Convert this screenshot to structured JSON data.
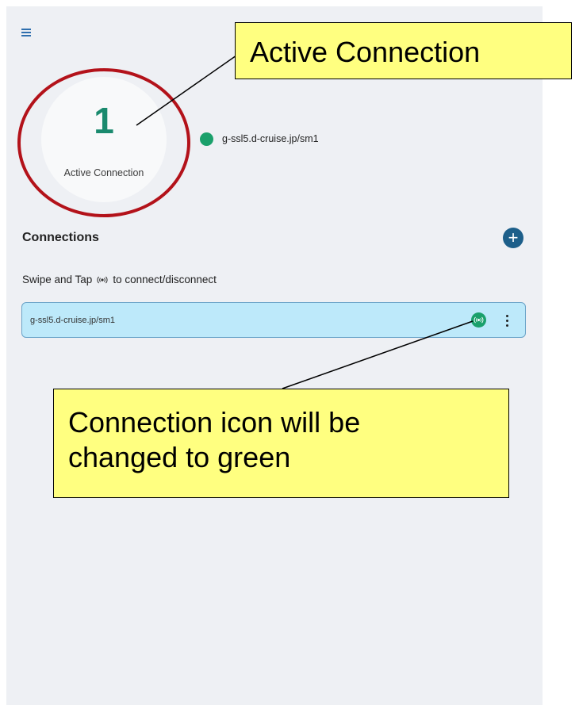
{
  "stats": {
    "count": "1",
    "label": "Active Connection"
  },
  "active": {
    "host": "g-ssl5.d-cruise.jp/sm1",
    "status_color": "#1aa06b"
  },
  "connections": {
    "title": "Connections",
    "hint_before": "Swipe and Tap",
    "hint_after": "to connect/disconnect",
    "items": [
      {
        "host": "g-ssl5.d-cruise.jp/sm1",
        "connected": true
      }
    ]
  },
  "annotations": {
    "callout_active": "Active Connection",
    "callout_icon_line1": "Connection icon will be",
    "callout_icon_line2": "changed to green"
  },
  "colors": {
    "accent": "#1d5f8a",
    "connected": "#1aa06b",
    "row_background": "#bde9fa",
    "callout_background": "#ffff80",
    "highlight_ring": "#b3121a"
  },
  "icons": {
    "menu": "hamburger-icon",
    "add": "plus-icon",
    "toggle": "broadcast-icon",
    "more": "vertical-dots-icon"
  }
}
